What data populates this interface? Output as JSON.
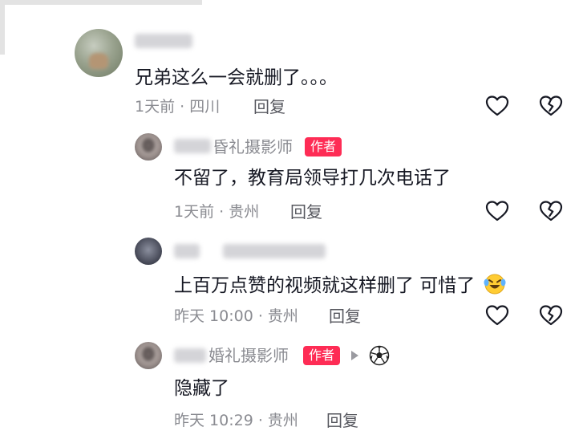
{
  "comments": [
    {
      "text": "兄弟这么一会就删了。。。",
      "time": "1天前",
      "location": "四川",
      "reply_label": "回复"
    },
    {
      "name": "婚礼摄影师",
      "name_visible": "昏礼摄影师",
      "badge": "作者",
      "text": "不留了，教育局领导打几次电话了",
      "time": "1天前",
      "location": "贵州",
      "reply_label": "回复"
    },
    {
      "text": "上百万点赞的视频就这样删了  可惜了",
      "emoji": "laughing-crying-emoji",
      "time": "昨天 10:00",
      "location": "贵州",
      "reply_label": "回复"
    },
    {
      "name": "婚礼摄影师",
      "badge": "作者",
      "secondary_icon": "soccer-ball-icon",
      "text": "隐藏了",
      "time": "昨天 10:29",
      "location": "贵州",
      "reply_label": "回复"
    }
  ],
  "sep": " · "
}
